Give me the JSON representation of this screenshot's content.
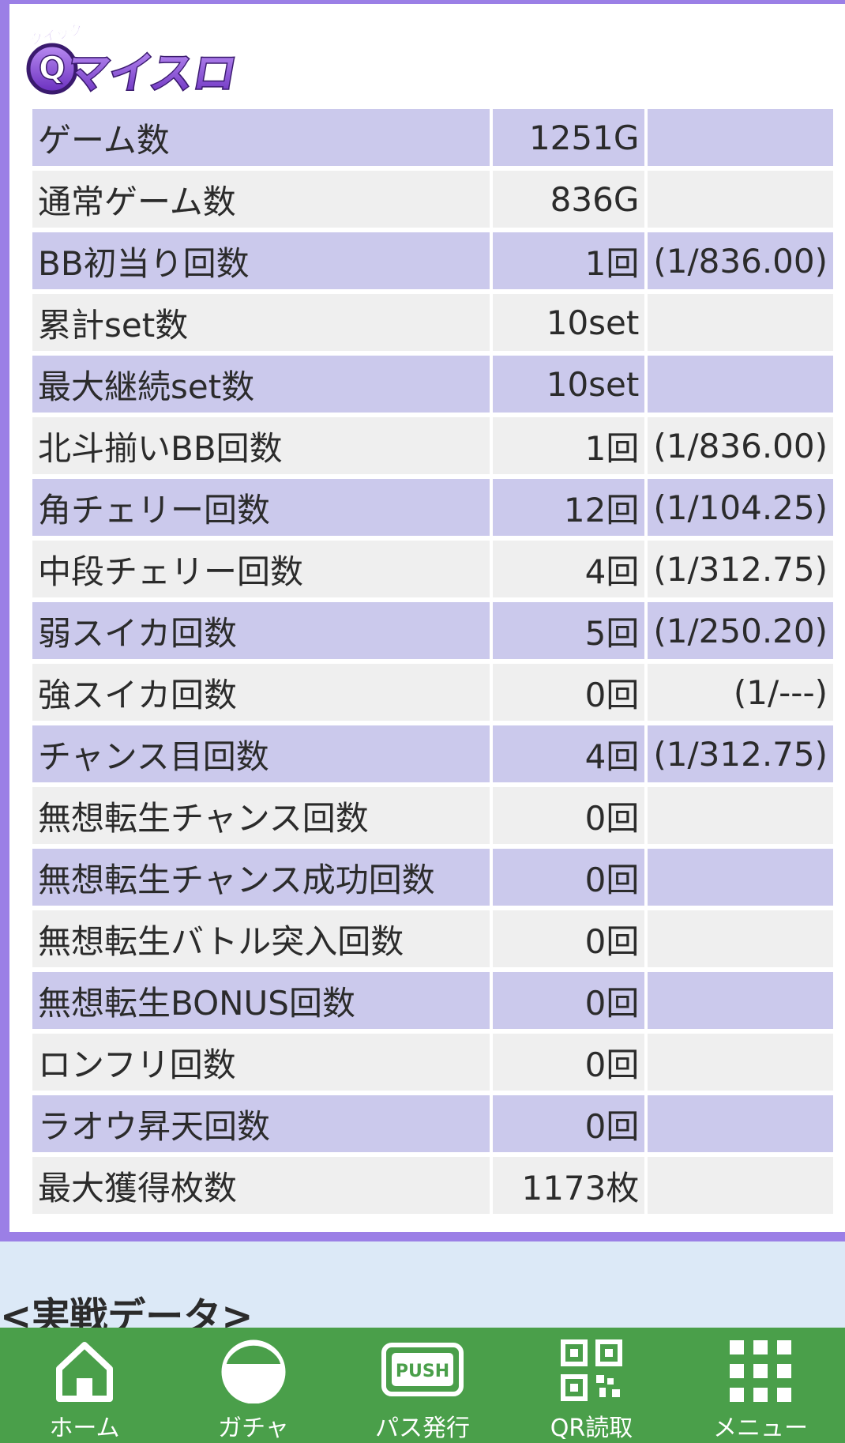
{
  "logo": {
    "text": "マイスロ",
    "prefix": "Q",
    "ruby": "クイック"
  },
  "stats": [
    {
      "label": "ゲーム数",
      "value": "1251G",
      "rate": ""
    },
    {
      "label": "通常ゲーム数",
      "value": "836G",
      "rate": ""
    },
    {
      "label": "BB初当り回数",
      "value": "1回",
      "rate": "(1/836.00)"
    },
    {
      "label": "累計set数",
      "value": "10set",
      "rate": ""
    },
    {
      "label": "最大継続set数",
      "value": "10set",
      "rate": ""
    },
    {
      "label": "北斗揃いBB回数",
      "value": "1回",
      "rate": "(1/836.00)"
    },
    {
      "label": "角チェリー回数",
      "value": "12回",
      "rate": "(1/104.25)"
    },
    {
      "label": "中段チェリー回数",
      "value": "4回",
      "rate": "(1/312.75)"
    },
    {
      "label": "弱スイカ回数",
      "value": "5回",
      "rate": "(1/250.20)"
    },
    {
      "label": "強スイカ回数",
      "value": "0回",
      "rate": "(1/---)"
    },
    {
      "label": "チャンス目回数",
      "value": "4回",
      "rate": "(1/312.75)"
    },
    {
      "label": "無想転生チャンス回数",
      "value": "0回",
      "rate": ""
    },
    {
      "label": "無想転生チャンス成功回数",
      "value": "0回",
      "rate": ""
    },
    {
      "label": "無想転生バトル突入回数",
      "value": "0回",
      "rate": ""
    },
    {
      "label": "無想転生BONUS回数",
      "value": "0回",
      "rate": ""
    },
    {
      "label": "ロンフリ回数",
      "value": "0回",
      "rate": ""
    },
    {
      "label": "ラオウ昇天回数",
      "value": "0回",
      "rate": ""
    },
    {
      "label": "最大獲得枚数",
      "value": "1173枚",
      "rate": ""
    }
  ],
  "section_title": "<実戦データ>",
  "nav": [
    {
      "label": "ホーム",
      "icon": "home-icon"
    },
    {
      "label": "ガチャ",
      "icon": "gacha-icon"
    },
    {
      "label": "パス発行",
      "icon": "push-icon"
    },
    {
      "label": "QR読取",
      "icon": "qr-icon"
    },
    {
      "label": "メニュー",
      "icon": "menu-grid-icon"
    }
  ],
  "push_badge": "PUSH",
  "colors": {
    "frame": "#9b7fe6",
    "row_alt": "#cbc9ec",
    "row_plain": "#efefef",
    "nav_bg": "#4a9f4a",
    "page_bg": "#dce9f7"
  }
}
